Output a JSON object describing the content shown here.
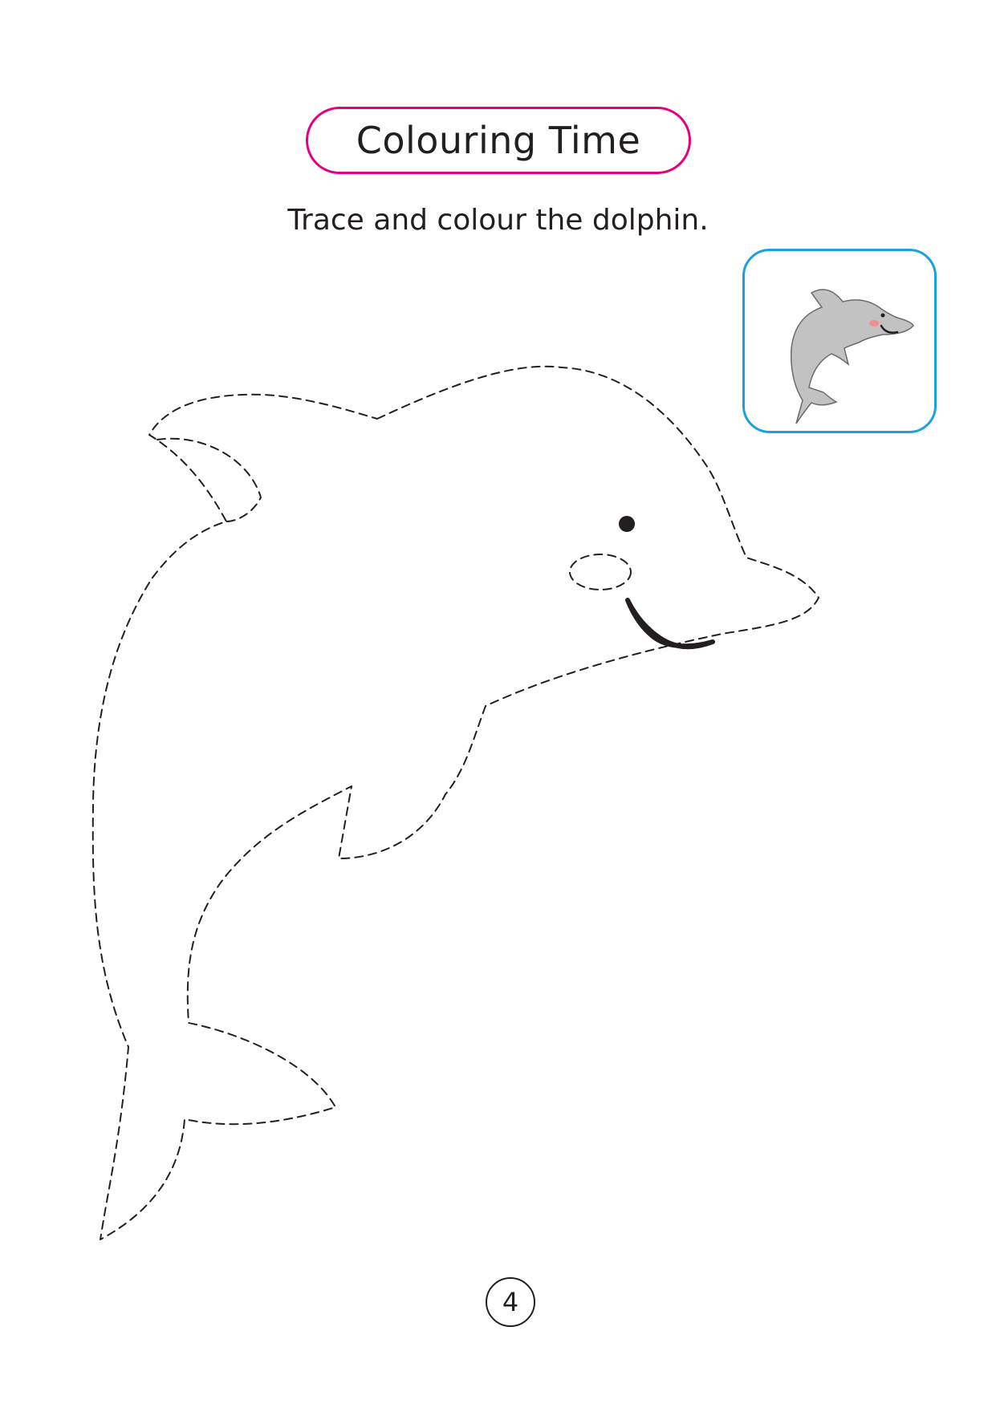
{
  "header": {
    "title": "Colouring Time"
  },
  "instruction": "Trace and colour the dolphin.",
  "reference_image": {
    "subject": "grey dolphin",
    "frame_color": "#1ba1dc",
    "fill_color": "#c2c2c2"
  },
  "tracing_outline": {
    "subject": "dolphin",
    "stroke_style": "dashed"
  },
  "page_number": "4",
  "colors": {
    "title_border": "#e6007e",
    "text": "#231f20"
  }
}
